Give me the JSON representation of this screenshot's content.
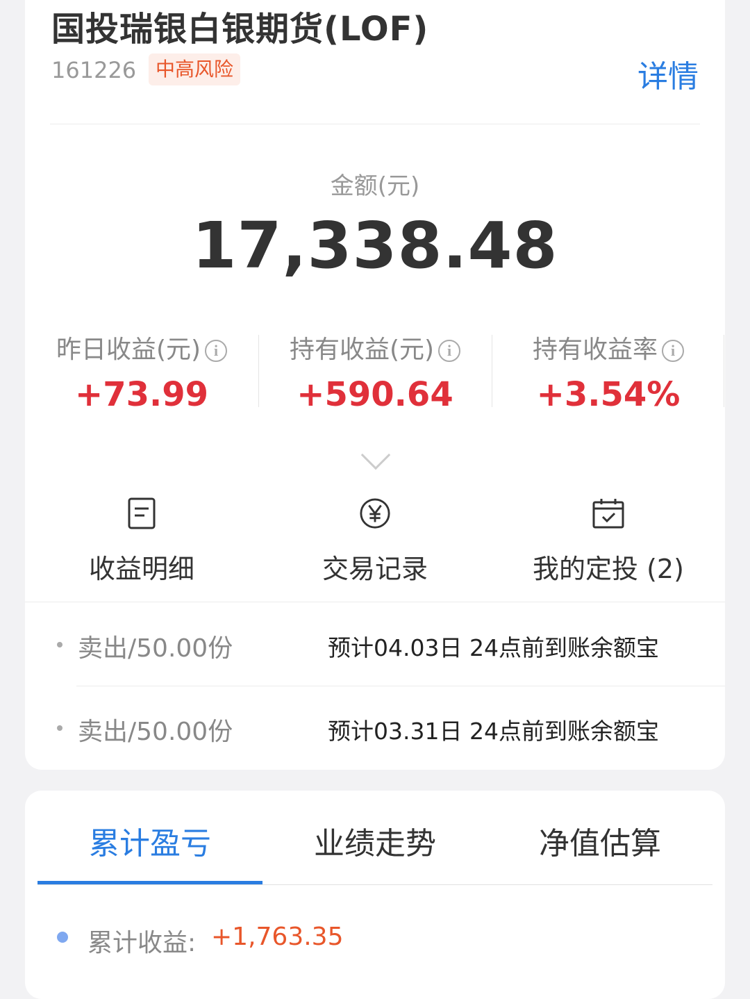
{
  "fund": {
    "title": "国投瑞银白银期货(LOF)",
    "code": "161226",
    "risk": "中高风险",
    "detail_label": "详情"
  },
  "amount": {
    "label": "金额(元)",
    "value": "17,338.48"
  },
  "stats": [
    {
      "label": "昨日收益(元)",
      "value": "+73.99"
    },
    {
      "label": "持有收益(元)",
      "value": "+590.64"
    },
    {
      "label": "持有收益率",
      "value": "+3.54%"
    }
  ],
  "actions": [
    {
      "label": "收益明细",
      "icon": "document-icon"
    },
    {
      "label": "交易记录",
      "icon": "yuan-circle-icon"
    },
    {
      "label": "我的定投 (2)",
      "icon": "calendar-check-icon"
    }
  ],
  "pending": [
    {
      "op": "卖出/50.00份",
      "note": "预计04.03日 24点前到账余额宝"
    },
    {
      "op": "卖出/50.00份",
      "note": "预计03.31日 24点前到账余额宝"
    }
  ],
  "tabs": [
    {
      "label": "累计盈亏",
      "active": true
    },
    {
      "label": "业绩走势",
      "active": false
    },
    {
      "label": "净值估算",
      "active": false
    }
  ],
  "cumulative": {
    "label": "累计收益:",
    "value": "+1,763.35"
  },
  "colors": {
    "accent": "#2a7de1",
    "gain": "#e0303a",
    "risk": "#e8562a"
  }
}
